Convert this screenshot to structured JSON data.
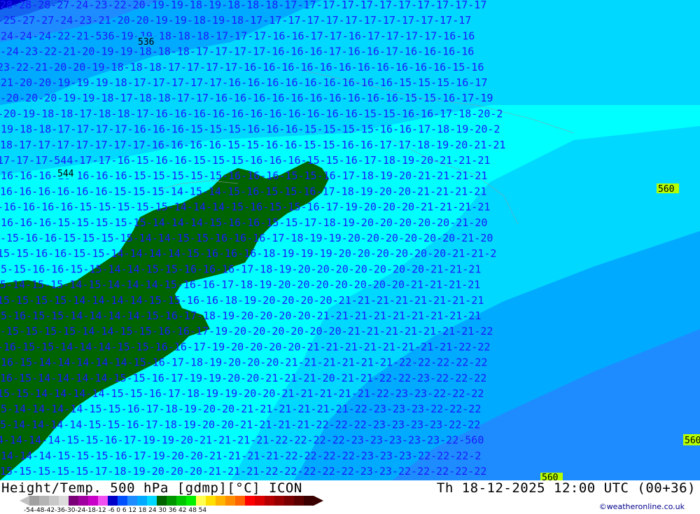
{
  "footer": {
    "title_left": "Height/Temp. 500 hPa [gdmp][°C] ICON",
    "title_right": "Th 18-12-2025 12:00 UTC (00+36)",
    "credit": "©weatheronline.co.uk",
    "scale_ticks": "-54-48-42-36-30-24-18-12 -6  0  6  12  18  24  30  36  42  48  54"
  },
  "colors": {
    "land": "#006400",
    "cyan": "#00ffff",
    "light_blue": "#00d8ff",
    "mid_blue": "#00aaff",
    "blue": "#1e8cff",
    "deep_blue": "#1464f0",
    "darkest_blue": "#0000c8",
    "height_label": "#b4ff00"
  },
  "height_labels": [
    "536",
    "544",
    "560",
    "560",
    "560"
  ],
  "temp_rows": [
    "28-28-28-27-24-23-22-20-19-19-18-19-18-18-18-17-17-17-17-17-17-17-17-17-17-17",
    "-25-27-27-24-23-21-20-20-19-19-18-19-18-17-17-17-17-17-17-17-17-17-17-17-17",
    "-24-24-24-22-21-536-19-19-18-18-18-17-17-17-16-16-17-17-16-17-17-17-17-16-16",
    "-24-23-22-21-20-19-19-18-18-18-17-17-17-17-16-16-16-17-16-16-17-16-16-16-16",
    "23-22-21-20-20-19-18-18-18-17-17-17-17-16-16-16-16-16-16-16-16-16-16-16-15-16",
    "-21-20-20-19-19-19-18-17-17-17-17-17-16-16-16-16-16-16-16-16-16-15-15-15-16-17",
    "-20-20-20-19-19-18-17-18-18-17-17-16-16-16-16-16-16-16-16-16-16-15-15-16-17-19",
    "-20-19-18-18-17-18-18-17-16-16-16-16-16-16-16-16-16-16-16-15-15-16-16-17-18-20-2",
    "-19-18-18-17-17-17-17-16-16-16-15-15-15-16-16-16-15-15-15-15-16-16-17-18-19-20-2",
    "18-17-17-17-17-17-17-17-16-16-16-16-15-15-16-16-15-15-16-16-17-17-18-19-20-21-21",
    "17-17-17-544-17-17-16-15-16-16-15-15-15-16-16-16-15-15-16-17-18-19-20-21-21-21",
    "-16-16-16-16-16-16-16-15-15-15-15-15-16-16-16-15-15-16-17-18-19-20-21-21-21-21",
    "16-16-16-16-16-16-15-15-15-14-15-14-15-16-15-15-16-17-18-19-20-20-21-21-21-21",
    "-16-16-16-16-15-15-15-15-15-14-14-14-15-16-15-15-16-17-19-20-20-20-21-21-21-21",
    "-16-16-16-15-15-15-15-15-14-14-14-15-16-16-15-15-17-18-19-20-20-20-20-20-21-20",
    "-15-16-16-15-15-15-15-14-14-15-15-16-16-16-17-18-19-19-20-20-20-20-20-20-21-20",
    "15-15-16-16-15-15-14-14-14-14-15-16-16-16-18-19-19-19-20-20-20-20-20-20-21-21-2",
    "15-15-16-16-15-15-14-14-15-15-16-16-16-17-18-19-20-20-20-20-20-20-20-21-21-21",
    "5-14-15-15-14-15-14-14-14-15-16-16-17-18-19-20-20-20-20-20-20-20-21-21-21-21",
    "15-15-15-15-14-14-14-14-15-15-16-16-18-19-20-20-20-20-21-21-21-21-21-21-21-21",
    "15-16-15-15-14-14-14-14-15-16-17-18-19-20-20-20-20-21-21-21-21-21-21-21-21-21",
    "-15-15-15-15-14-14-15-15-16-16-17-19-20-20-20-20-20-20-21-21-21-21-21-21-21-22",
    "-16-15-15-14-14-14-15-15-16-16-17-19-20-20-20-20-21-21-21-21-21-21-21-21-22-22",
    "-16-15-14-14-14-14-14-15-16-17-18-19-20-20-20-21-21-21-21-21-21-22-22-22-22-22",
    "16-15-14-14-14-14-15-15-16-17-19-19-20-20-21-21-21-20-21-21-22-22-23-22-22-22",
    "15-15-14-14-14-14-15-15-16-17-18-19-19-20-20-21-21-21-21-21-22-23-23-22-22-22",
    "15-14-14-14-14-15-15-16-17-18-19-20-20-21-21-21-21-21-21-22-23-23-23-22-22-22",
    "5-14-14-14-14-15-15-16-17-18-19-20-20-21-21-21-21-22-22-22-23-23-23-23-22-22",
    "4-14-14-14-15-15-16-17-19-19-20-21-21-21-21-22-22-22-22-23-23-23-23-23-22-560",
    "-14-14-14-15-15-15-16-17-19-20-20-21-21-21-21-22-22-22-22-23-23-23-22-22-22-2",
    "15-15-15-15-15-17-18-19-20-20-20-21-21-21-22-22-22-22-22-23-23-22-22-22-22-22"
  ]
}
